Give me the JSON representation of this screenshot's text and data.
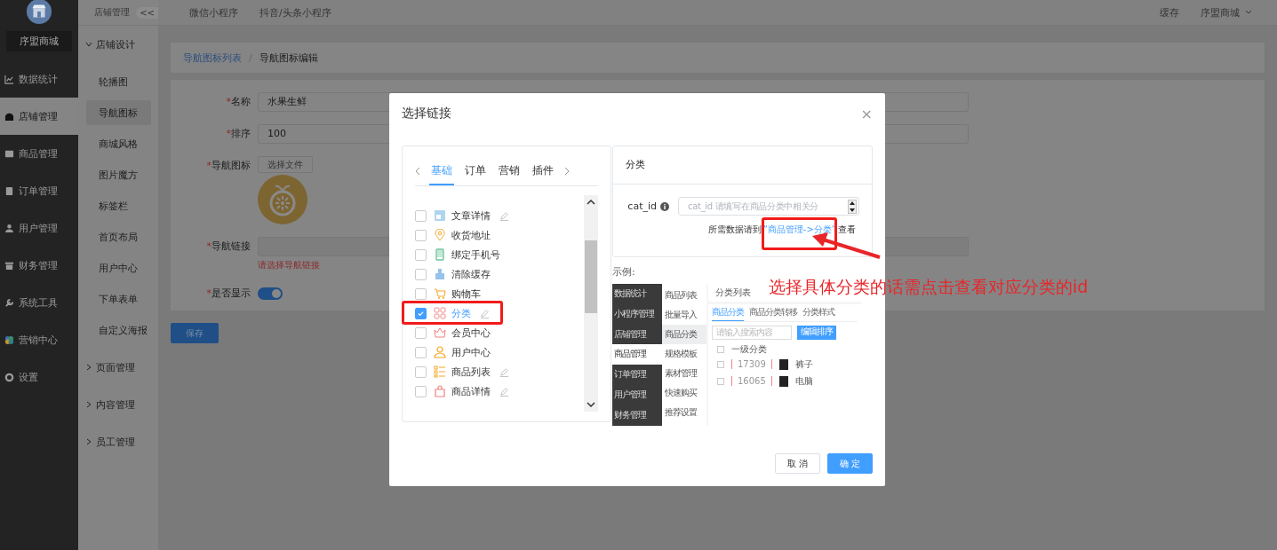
{
  "brand": {
    "name": "序盟商城"
  },
  "main_nav": [
    {
      "label": "数据统计",
      "selected": false
    },
    {
      "label": "店铺管理",
      "selected": true
    },
    {
      "label": "商品管理",
      "selected": false
    },
    {
      "label": "订单管理",
      "selected": false
    },
    {
      "label": "用户管理",
      "selected": false
    },
    {
      "label": "财务管理",
      "selected": false
    },
    {
      "label": "系统工具",
      "selected": false
    },
    {
      "label": "营销中心",
      "selected": false
    },
    {
      "label": "设置",
      "selected": false
    }
  ],
  "sub_nav": {
    "title": "店铺管理",
    "collapse": "<<",
    "groups": [
      {
        "label": "店铺设计",
        "expanded": true,
        "children": [
          {
            "label": "轮播图",
            "selected": false
          },
          {
            "label": "导航图标",
            "selected": true
          },
          {
            "label": "商城风格",
            "selected": false
          },
          {
            "label": "图片魔方",
            "selected": false
          },
          {
            "label": "标签栏",
            "selected": false
          },
          {
            "label": "首页布局",
            "selected": false
          },
          {
            "label": "用户中心",
            "selected": false
          },
          {
            "label": "下单表单",
            "selected": false
          },
          {
            "label": "自定义海报",
            "selected": false
          }
        ]
      },
      {
        "label": "页面管理",
        "expanded": false
      },
      {
        "label": "内容管理",
        "expanded": false
      },
      {
        "label": "员工管理",
        "expanded": false
      }
    ]
  },
  "top_tabs": [
    "微信小程序",
    "抖音/头条小程序"
  ],
  "top_right": {
    "cache": "缓存",
    "user": "序盟商城"
  },
  "breadcrumb": {
    "items": [
      "导航图标列表",
      "导航图标编辑"
    ],
    "separator": "/"
  },
  "form": {
    "fields": [
      {
        "kind": "text",
        "label": "名称",
        "required_mark": "*",
        "value": "水果生鲜"
      },
      {
        "kind": "text",
        "label": "排序",
        "required_mark": "*",
        "value": "100"
      },
      {
        "kind": "image",
        "label": "导航图标",
        "required_mark": "*",
        "button": "选择文件"
      },
      {
        "kind": "link",
        "label": "导航链接",
        "required_mark": "*",
        "error": "请选择导航链接"
      },
      {
        "kind": "switch",
        "label": "是否显示",
        "required_mark": "*",
        "on": true
      }
    ],
    "save": "保存"
  },
  "modal": {
    "title": "选择链接",
    "close": "×",
    "tabs": [
      {
        "label": "基础",
        "selected": true
      },
      {
        "label": "订单",
        "selected": false
      },
      {
        "label": "营销",
        "selected": false
      },
      {
        "label": "插件",
        "selected": false
      }
    ],
    "items": [
      {
        "label": "文章详情",
        "checked": false,
        "editable": true
      },
      {
        "label": "收货地址",
        "checked": false,
        "editable": false
      },
      {
        "label": "绑定手机号",
        "checked": false,
        "editable": false
      },
      {
        "label": "清除缓存",
        "checked": false,
        "editable": false
      },
      {
        "label": "购物车",
        "checked": false,
        "editable": false
      },
      {
        "label": "分类",
        "checked": true,
        "editable": true
      },
      {
        "label": "会员中心",
        "checked": false,
        "editable": false
      },
      {
        "label": "用户中心",
        "checked": false,
        "editable": false
      },
      {
        "label": "商品列表",
        "checked": false,
        "editable": true
      },
      {
        "label": "商品详情",
        "checked": false,
        "editable": true
      }
    ],
    "detail": {
      "title": "分类",
      "field_label": "cat_id",
      "placeholder": "cat_id 请填写在商品分类中相关分",
      "hint_before": "所需数据请到",
      "link": "“商品管理->分类”",
      "hint_after": "查看",
      "example_label": "示例:",
      "example": {
        "nav": [
          {
            "label": "数据统计",
            "selected": false
          },
          {
            "label": "小程序管理",
            "selected": false
          },
          {
            "label": "店铺管理",
            "selected": false
          },
          {
            "label": "商品管理",
            "selected": true
          },
          {
            "label": "订单管理",
            "selected": false
          },
          {
            "label": "用户管理",
            "selected": false
          },
          {
            "label": "财务管理",
            "selected": false
          }
        ],
        "sub_nav": [
          {
            "label": "商品列表",
            "selected": false
          },
          {
            "label": "批量导入",
            "selected": false
          },
          {
            "label": "商品分类",
            "selected": true
          },
          {
            "label": "规格模板",
            "selected": false
          },
          {
            "label": "素材管理",
            "selected": false
          },
          {
            "label": "快速购买",
            "selected": false
          },
          {
            "label": "推荐设置",
            "selected": false
          }
        ],
        "title": "分类列表",
        "tabs": [
          {
            "label": "商品分类",
            "selected": true
          },
          {
            "label": "商品分类转移",
            "selected": false
          },
          {
            "label": "分类样式",
            "selected": false
          }
        ],
        "search_placeholder": "请输入搜索内容",
        "button": "编辑排序",
        "header": "一级分类",
        "rows": [
          {
            "id": "17309",
            "name": "裤子"
          },
          {
            "id": "16065",
            "name": "电脑"
          }
        ]
      }
    },
    "buttons": [
      {
        "label": "取 消",
        "kind": "secondary"
      },
      {
        "label": "确 定",
        "kind": "primary"
      }
    ]
  },
  "annotation": {
    "text": "选择具体分类的话需点击查看对应分类的id"
  }
}
